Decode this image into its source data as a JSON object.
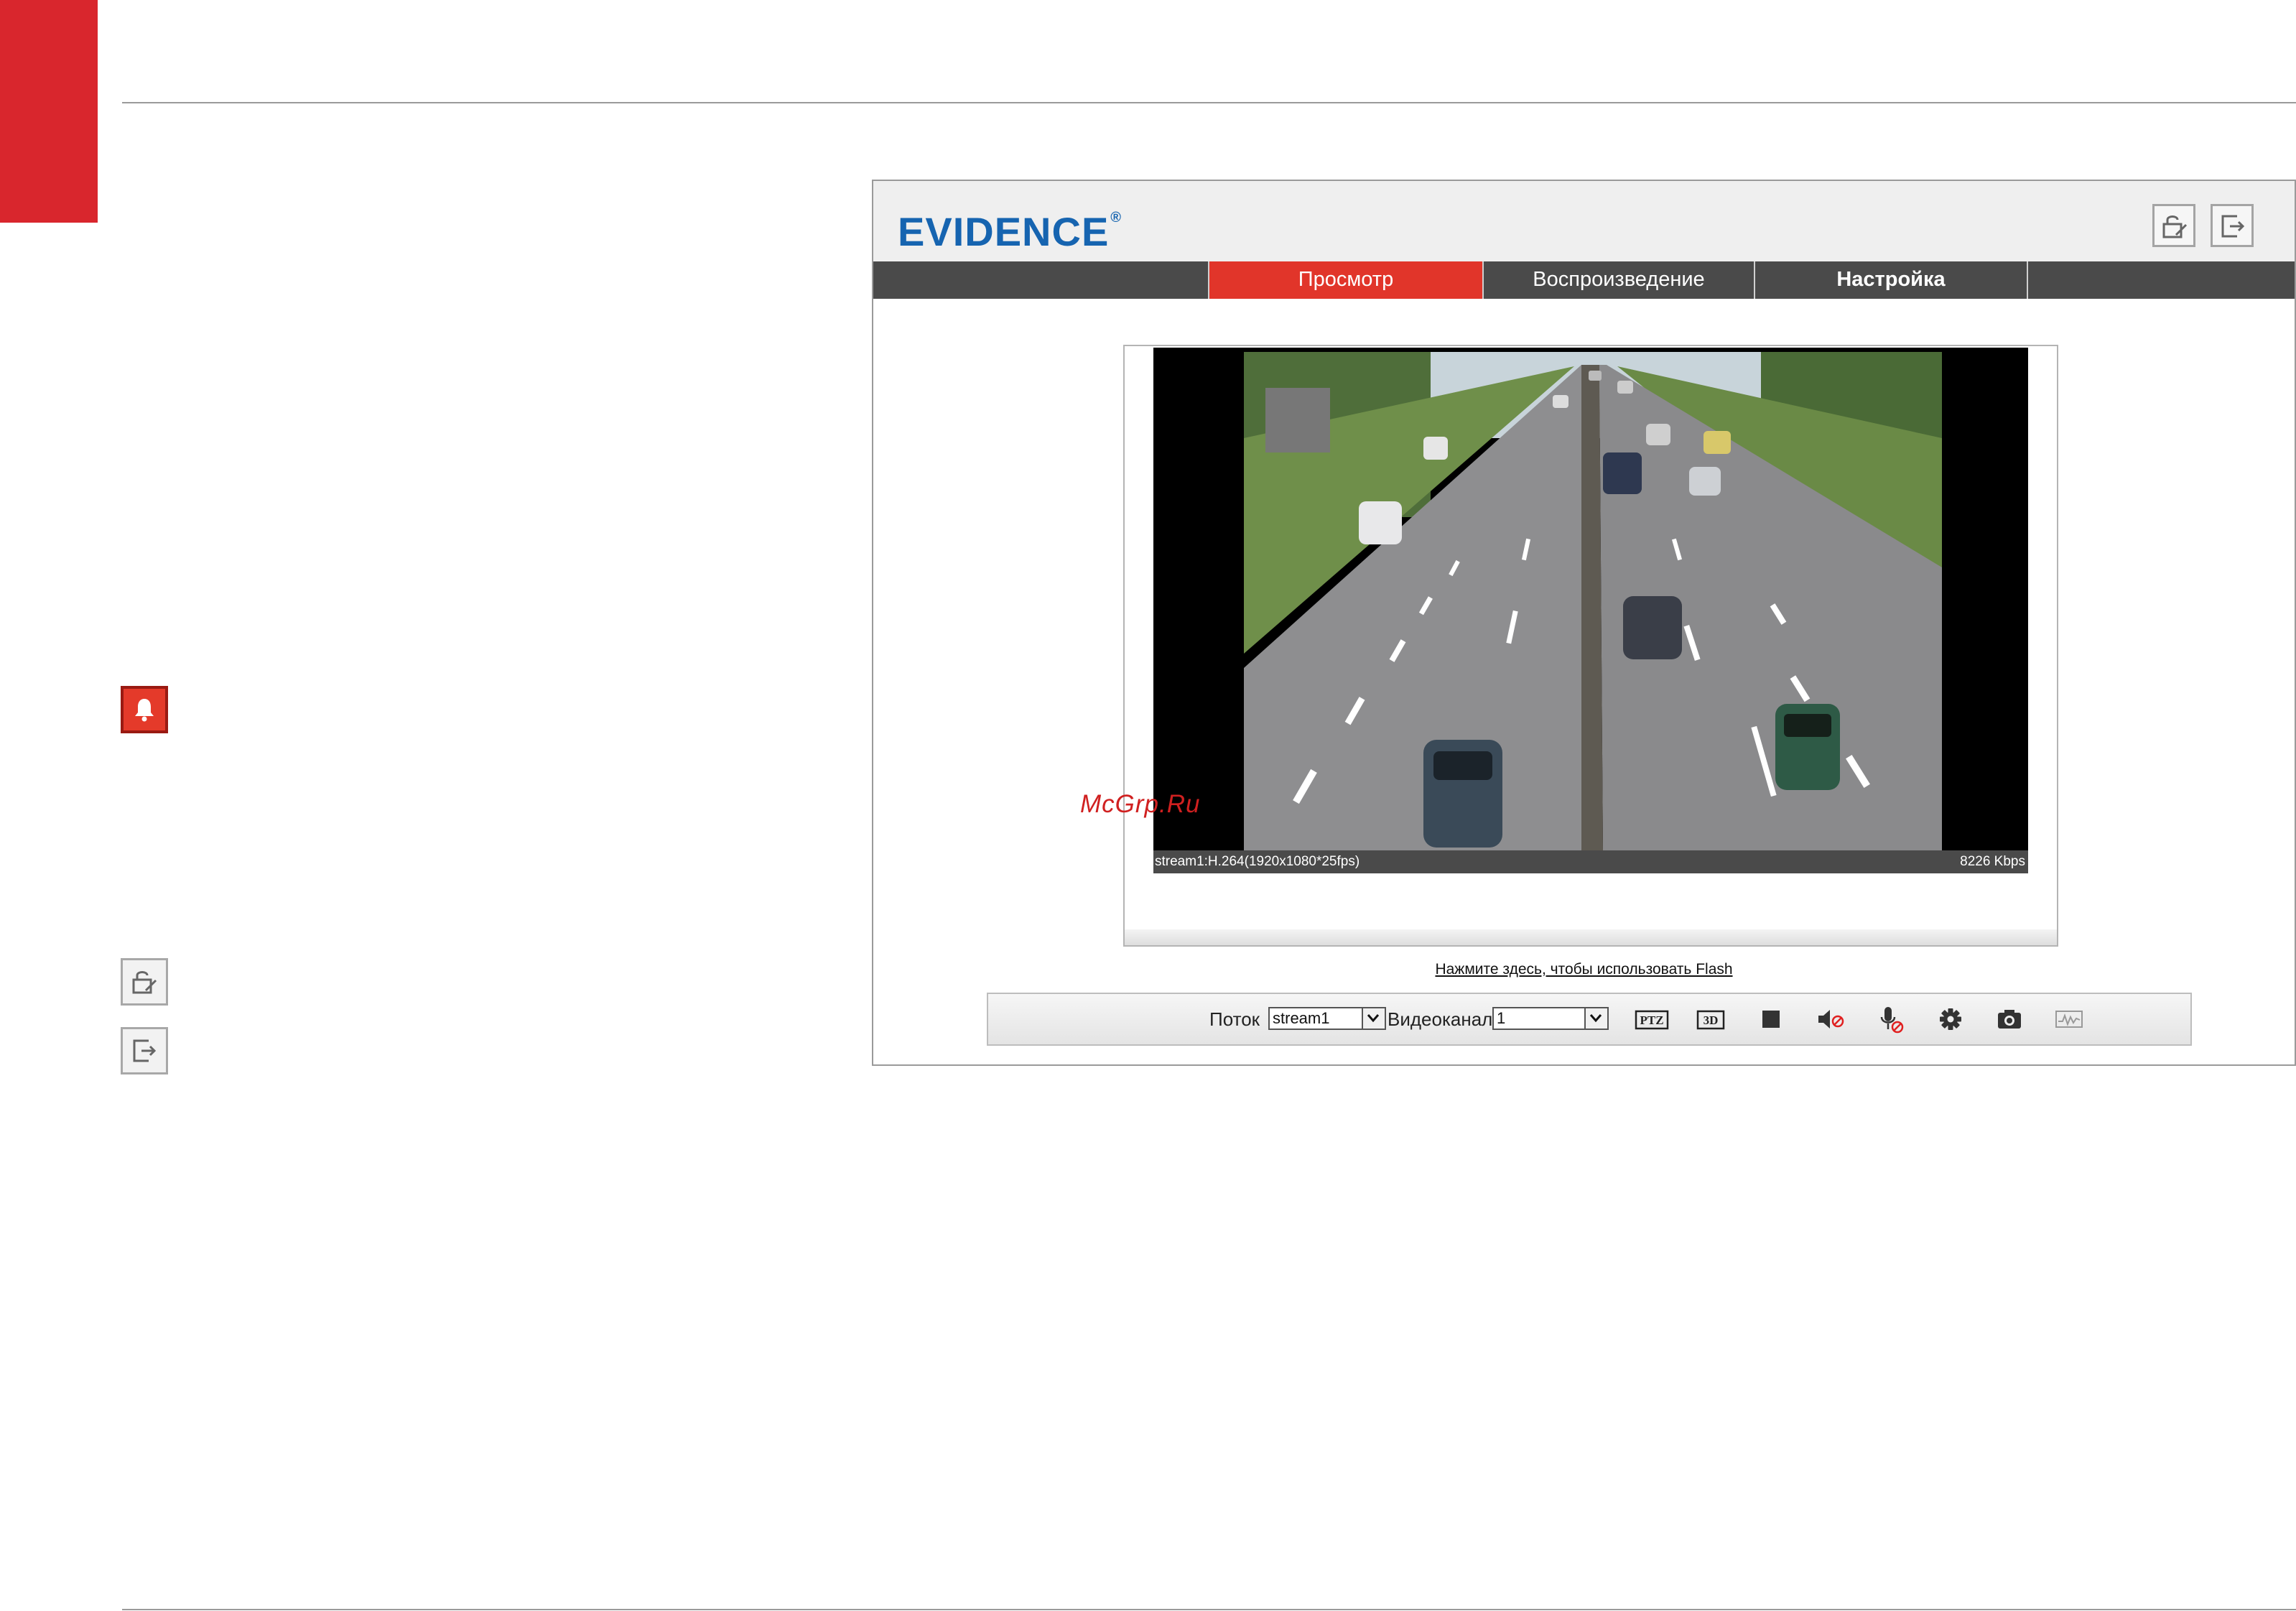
{
  "app": {
    "logo": "EVIDENCE",
    "logo_mark": "®"
  },
  "nav": {
    "tabs": [
      {
        "label": "Просмотр",
        "active": true
      },
      {
        "label": "Воспроизведение",
        "active": false
      },
      {
        "label": "Настройка",
        "active": false
      }
    ]
  },
  "video": {
    "status_left": "stream1:H.264(1920x1080*25fps)",
    "status_right": "8226 Kbps"
  },
  "flash_link": "Нажмите здесь, чтобы использовать Flash",
  "toolbar": {
    "stream_label": "Поток",
    "stream_value": "stream1",
    "channel_label": "Видеоканал",
    "channel_value": "1",
    "ptz_label": "PTZ",
    "threed_label": "3D",
    "icons": [
      "ptz-icon",
      "3d-icon",
      "stop-icon",
      "sound-muted-icon",
      "microphone-off-icon",
      "gear-icon",
      "camera-icon",
      "waveform-icon"
    ]
  },
  "watermark": "McGrp.Ru",
  "colors": {
    "accent_red": "#d9262d",
    "nav_active": "#e1352a",
    "nav_bg": "#4a4a4a",
    "logo_blue": "#1664b0"
  }
}
